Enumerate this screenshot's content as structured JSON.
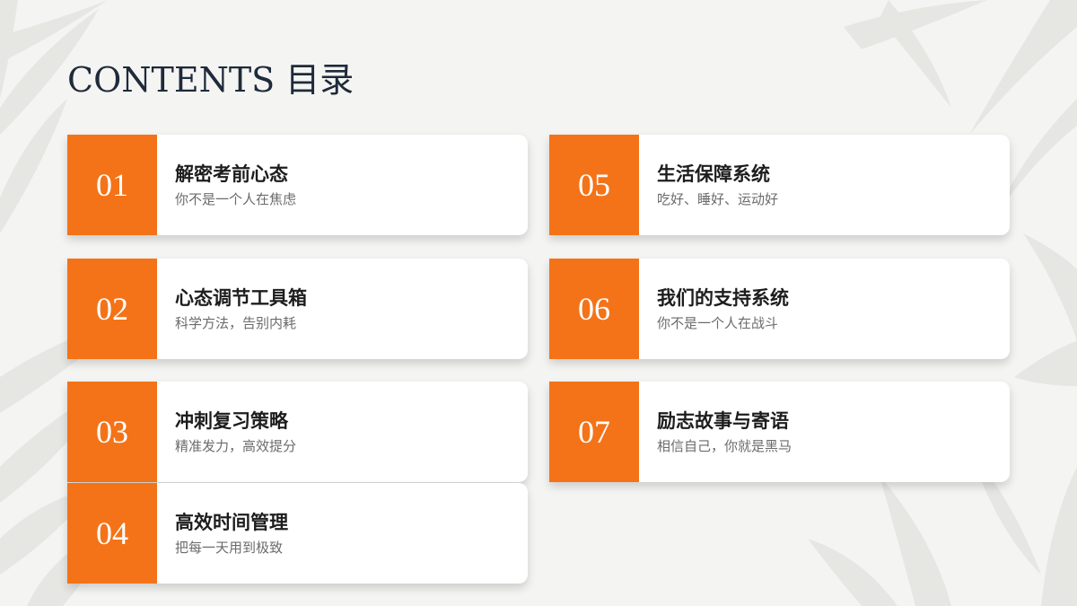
{
  "page": {
    "title": "CONTENTS 目录"
  },
  "items": [
    {
      "number": "01",
      "title": "解密考前心态",
      "subtitle": "你不是一个人在焦虑"
    },
    {
      "number": "02",
      "title": "心态调节工具箱",
      "subtitle": "科学方法，告别内耗"
    },
    {
      "number": "03",
      "title": "冲刺复习策略",
      "subtitle": "精准发力，高效提分"
    },
    {
      "number": "04",
      "title": "高效时间管理",
      "subtitle": "把每一天用到极致"
    },
    {
      "number": "05",
      "title": "生活保障系统",
      "subtitle": "吃好、睡好、运动好"
    },
    {
      "number": "06",
      "title": "我们的支持系统",
      "subtitle": "你不是一个人在战斗"
    },
    {
      "number": "07",
      "title": "励志故事与寄语",
      "subtitle": "相信自己，你就是黑马"
    }
  ],
  "colors": {
    "accent": "#f47318",
    "background": "#f4f4f2",
    "title": "#1f2a3a"
  }
}
